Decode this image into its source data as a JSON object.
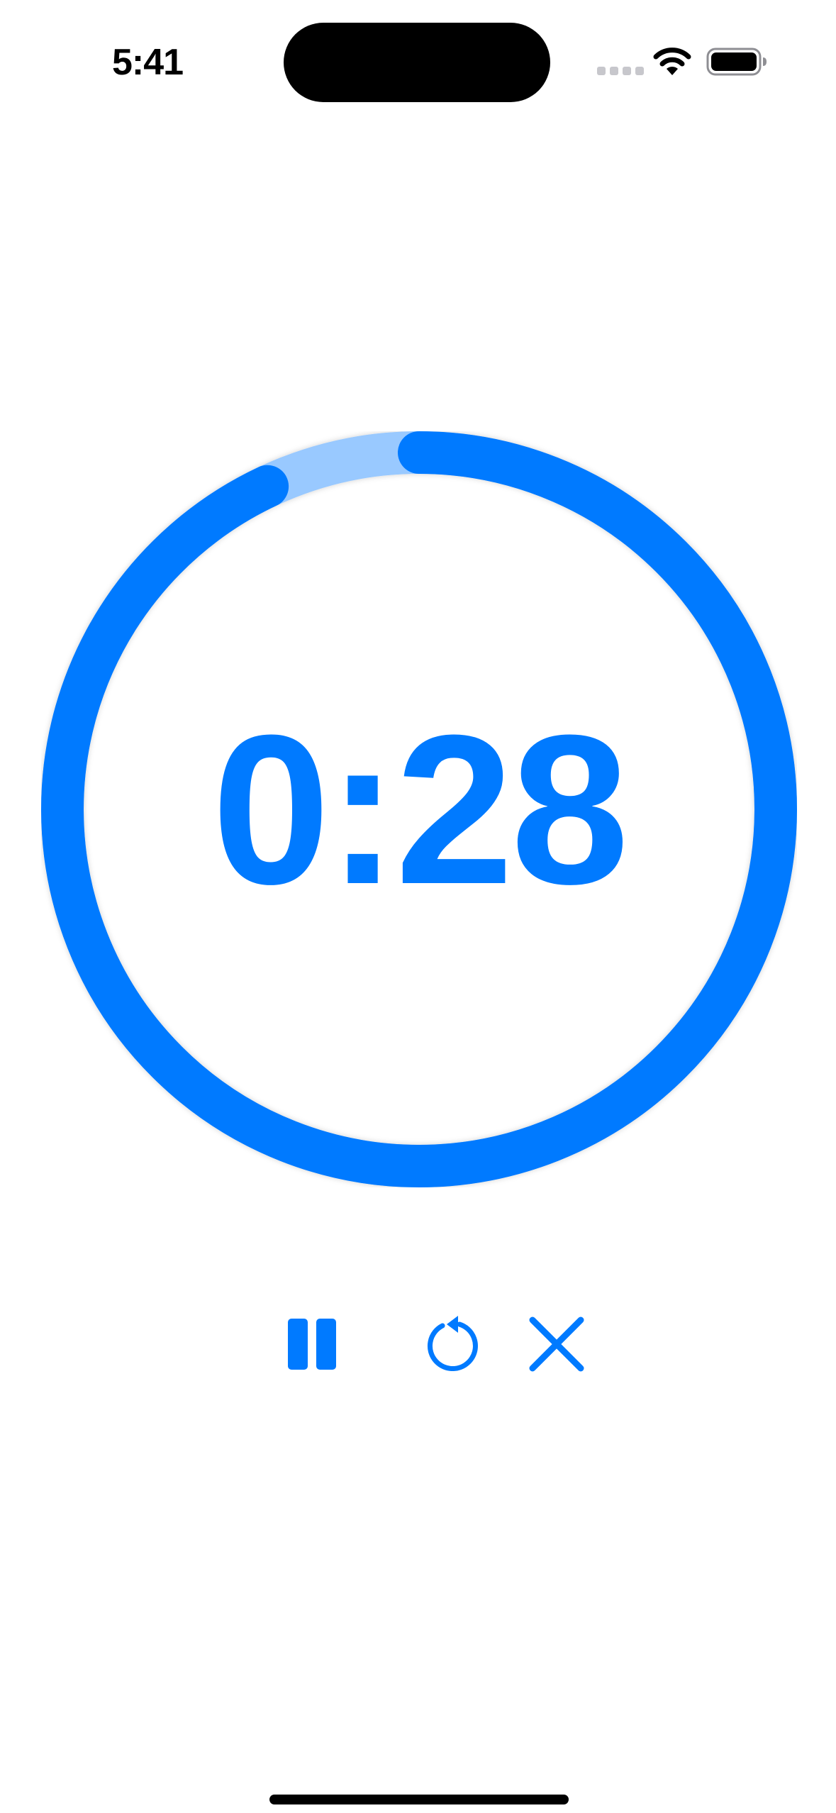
{
  "status_bar": {
    "time": "5:41",
    "icons": [
      "cellular-signal-icon",
      "wifi-icon",
      "battery-icon"
    ]
  },
  "timer": {
    "remaining": "0:28",
    "progress": 0.93,
    "colors": {
      "accent": "#007aff",
      "track": "#99c9ff"
    }
  },
  "controls": {
    "buttons": [
      {
        "name": "pause-button",
        "icon": "pause-icon"
      },
      {
        "name": "reset-button",
        "icon": "arrow-counterclockwise-icon"
      },
      {
        "name": "close-button",
        "icon": "close-icon"
      }
    ]
  }
}
